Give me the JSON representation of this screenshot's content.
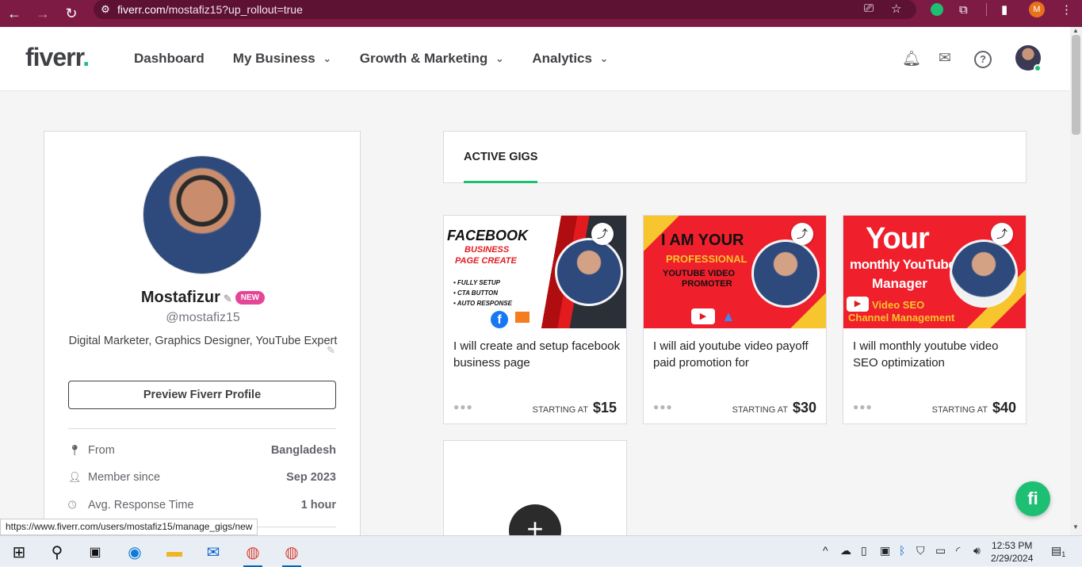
{
  "browser": {
    "url_host": "fiverr.com",
    "url_path": "/mostafiz15?up_rollout=true",
    "profile_letter": "M"
  },
  "header": {
    "logo": "fiverr",
    "logo_dot": ".",
    "menu": [
      {
        "label": "Dashboard",
        "has_dropdown": false
      },
      {
        "label": "My Business",
        "has_dropdown": true
      },
      {
        "label": "Growth & Marketing",
        "has_dropdown": true
      },
      {
        "label": "Analytics",
        "has_dropdown": true
      }
    ]
  },
  "profile": {
    "name": "Mostafizur",
    "badge": "NEW",
    "handle": "@mostafiz15",
    "description": "Digital Marketer, Graphics Designer, YouTube Expert",
    "preview_button": "Preview Fiverr Profile",
    "stats": [
      {
        "icon": "location-pin-icon",
        "label": "From",
        "value": "Bangladesh"
      },
      {
        "icon": "user-icon",
        "label": "Member since",
        "value": "Sep 2023"
      },
      {
        "icon": "clock-icon",
        "label": "Avg. Response Time",
        "value": "1 hour"
      }
    ]
  },
  "tabs": {
    "active": "ACTIVE GIGS"
  },
  "gigs": [
    {
      "title": "I will create and setup facebook business page",
      "starting_label": "STARTING AT",
      "price": "$15",
      "thumb_lines": [
        "FACEBOOK",
        "BUSINESS",
        "PAGE CREATE",
        "• FULLY SETUP",
        "• CTA BUTTON",
        "• AUTO RESPONSE"
      ]
    },
    {
      "title": "I will aid youtube video payoff paid promotion for",
      "starting_label": "STARTING AT",
      "price": "$30",
      "thumb_lines": [
        "I AM YOUR",
        "PROFESSIONAL",
        "YOUTUBE VIDEO",
        "PROMOTER"
      ]
    },
    {
      "title": "I will monthly youtube video SEO optimization",
      "starting_label": "STARTING AT",
      "price": "$40",
      "thumb_lines": [
        "Your",
        "monthly YouTube",
        "Manager",
        "Video SEO",
        "Channel Management"
      ]
    }
  ],
  "fab_label": "fi",
  "status_bar_url": "https://www.fiverr.com/users/mostafiz15/manage_gigs/new",
  "taskbar": {
    "time": "12:53 PM",
    "date": "2/29/2024",
    "notification_count": "1"
  },
  "colors": {
    "brand_green": "#1dbf73",
    "chrome_bg": "#7d1b45",
    "new_badge": "#e54597"
  }
}
